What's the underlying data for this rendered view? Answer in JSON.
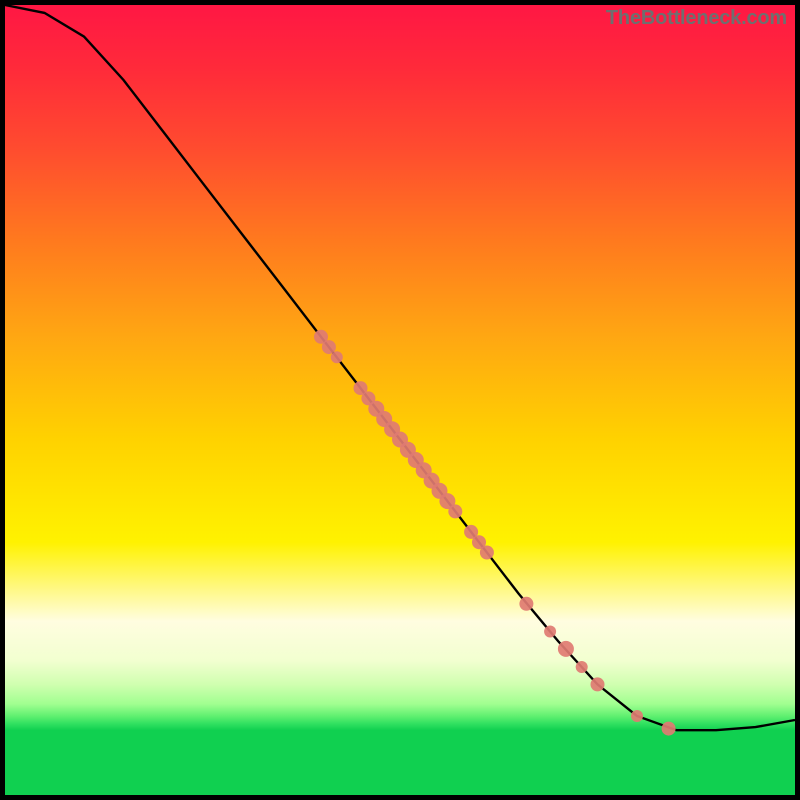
{
  "watermark": "TheBottleneck.com",
  "chart_data": {
    "type": "line",
    "title": "",
    "xlabel": "",
    "ylabel": "",
    "xlim": [
      0,
      100
    ],
    "ylim": [
      0,
      100
    ],
    "grid": false,
    "curve": [
      {
        "x": 0,
        "y": 100
      },
      {
        "x": 5,
        "y": 99
      },
      {
        "x": 10,
        "y": 96
      },
      {
        "x": 15,
        "y": 90.5
      },
      {
        "x": 20,
        "y": 84
      },
      {
        "x": 25,
        "y": 77.5
      },
      {
        "x": 30,
        "y": 71
      },
      {
        "x": 35,
        "y": 64.5
      },
      {
        "x": 40,
        "y": 58
      },
      {
        "x": 45,
        "y": 51.5
      },
      {
        "x": 50,
        "y": 45
      },
      {
        "x": 55,
        "y": 38.5
      },
      {
        "x": 60,
        "y": 32
      },
      {
        "x": 65,
        "y": 25.5
      },
      {
        "x": 70,
        "y": 19.5
      },
      {
        "x": 75,
        "y": 14
      },
      {
        "x": 80,
        "y": 10
      },
      {
        "x": 85,
        "y": 8.2
      },
      {
        "x": 90,
        "y": 8.2
      },
      {
        "x": 95,
        "y": 8.6
      },
      {
        "x": 100,
        "y": 9.5
      }
    ],
    "markers": [
      {
        "x": 40,
        "y": 58.0,
        "r": 7
      },
      {
        "x": 41,
        "y": 56.7,
        "r": 7
      },
      {
        "x": 42,
        "y": 55.4,
        "r": 6
      },
      {
        "x": 45,
        "y": 51.5,
        "r": 7
      },
      {
        "x": 46,
        "y": 50.2,
        "r": 7
      },
      {
        "x": 47,
        "y": 48.9,
        "r": 8
      },
      {
        "x": 48,
        "y": 47.6,
        "r": 8
      },
      {
        "x": 49,
        "y": 46.3,
        "r": 8
      },
      {
        "x": 50,
        "y": 45.0,
        "r": 8
      },
      {
        "x": 51,
        "y": 43.7,
        "r": 8
      },
      {
        "x": 52,
        "y": 42.4,
        "r": 8
      },
      {
        "x": 53,
        "y": 41.1,
        "r": 8
      },
      {
        "x": 54,
        "y": 39.8,
        "r": 8
      },
      {
        "x": 55,
        "y": 38.5,
        "r": 8
      },
      {
        "x": 56,
        "y": 37.2,
        "r": 8
      },
      {
        "x": 57,
        "y": 35.9,
        "r": 7
      },
      {
        "x": 59,
        "y": 33.3,
        "r": 7
      },
      {
        "x": 60,
        "y": 32.0,
        "r": 7
      },
      {
        "x": 61,
        "y": 30.7,
        "r": 7
      },
      {
        "x": 66,
        "y": 24.2,
        "r": 7
      },
      {
        "x": 69,
        "y": 20.7,
        "r": 6
      },
      {
        "x": 71,
        "y": 18.5,
        "r": 8
      },
      {
        "x": 73,
        "y": 16.2,
        "r": 6
      },
      {
        "x": 75,
        "y": 14.0,
        "r": 7
      },
      {
        "x": 80,
        "y": 10.0,
        "r": 6
      },
      {
        "x": 84,
        "y": 8.4,
        "r": 7
      }
    ],
    "marker_color": "#e07b72",
    "line_color": "#000000"
  }
}
